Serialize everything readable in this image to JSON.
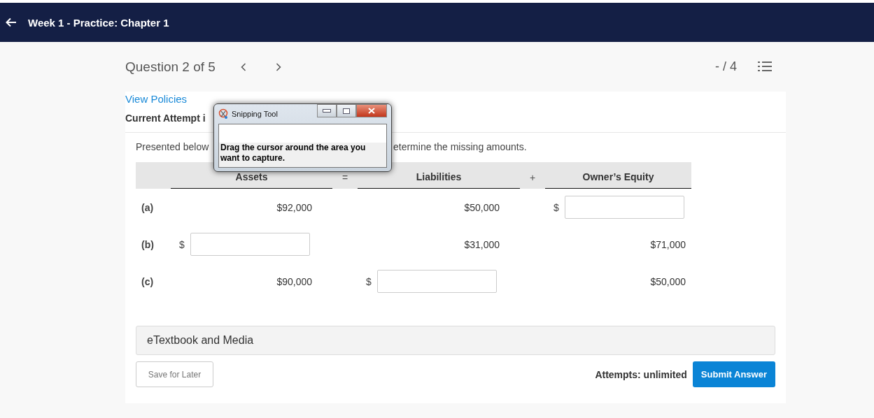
{
  "header": {
    "title": "Week 1 - Practice: Chapter 1"
  },
  "question_nav": {
    "label": "Question 2 of 5",
    "score": "- / 4"
  },
  "policies_link": "View Policies",
  "attempt_status": "Current Attempt i",
  "intro": [
    "Presented below",
    "etermine the missing amounts."
  ],
  "table": {
    "columns": [
      {
        "kind": "label"
      },
      {
        "kind": "heading",
        "label": "Assets"
      },
      {
        "kind": "operator",
        "label": "="
      },
      {
        "kind": "heading",
        "label": "Liabilities"
      },
      {
        "kind": "operator",
        "label": "+"
      },
      {
        "kind": "heading",
        "label": "Owner’s Equity"
      }
    ],
    "rows": [
      {
        "label": "(a)",
        "cells": [
          {
            "kind": "value",
            "text": "$92,000"
          },
          {
            "kind": "blank"
          },
          {
            "kind": "value",
            "text": "$50,000"
          },
          {
            "kind": "blank"
          },
          {
            "kind": "input",
            "prefix": "$"
          }
        ]
      },
      {
        "label": "(b)",
        "cells": [
          {
            "kind": "input",
            "prefix": "$"
          },
          {
            "kind": "blank"
          },
          {
            "kind": "value",
            "text": "$31,000"
          },
          {
            "kind": "blank"
          },
          {
            "kind": "value",
            "text": "$71,000"
          }
        ]
      },
      {
        "label": "(c)",
        "cells": [
          {
            "kind": "value",
            "text": "$90,000"
          },
          {
            "kind": "blank"
          },
          {
            "kind": "input",
            "prefix": "$"
          },
          {
            "kind": "blank"
          },
          {
            "kind": "value",
            "text": "$50,000"
          }
        ]
      }
    ]
  },
  "media_panel": "eTextbook and Media",
  "save_button": "Save for Later",
  "attempts": "Attempts: unlimited",
  "submit_button": "Submit Answer",
  "overlay_window": {
    "title": "Snipping Tool",
    "message": "Drag the cursor around the area you want to capture."
  }
}
